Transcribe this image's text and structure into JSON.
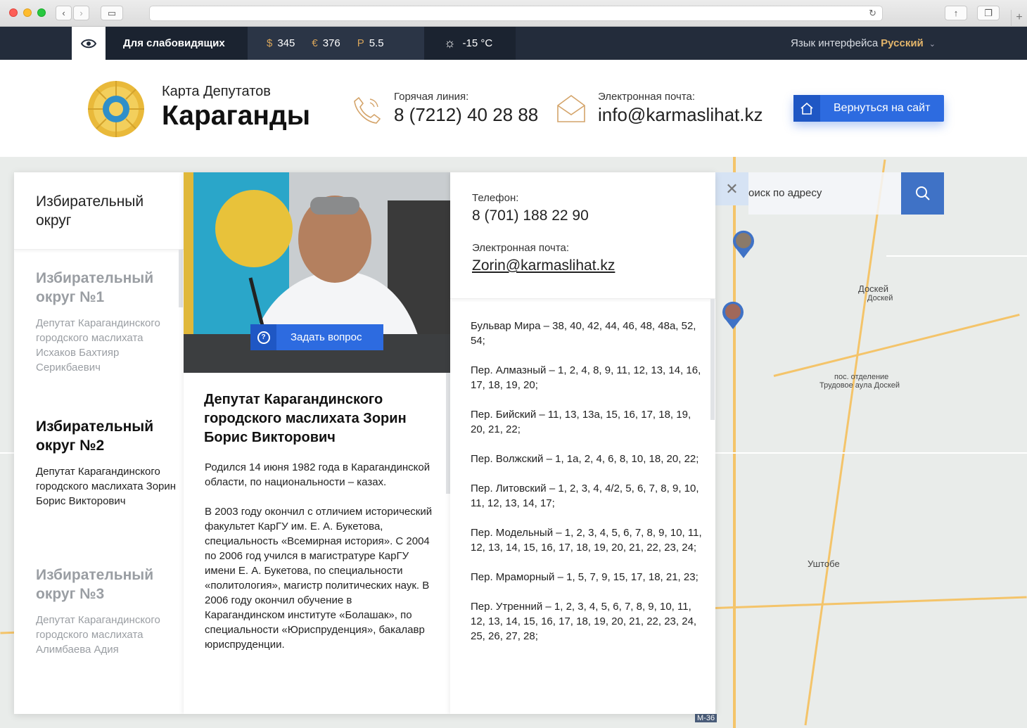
{
  "browser": {
    "url": ""
  },
  "topbar": {
    "low_vision_label": "Для слабовидящих",
    "currencies": [
      {
        "symbol": "$",
        "value": "345"
      },
      {
        "symbol": "€",
        "value": "376"
      },
      {
        "symbol": "Р",
        "value": "5.5"
      }
    ],
    "weather": "-15 °C",
    "language_label": "Язык интерфейса",
    "language_value": "Русский"
  },
  "header": {
    "brand_sub": "Карта Депутатов",
    "brand_title": "Караганды",
    "hotline_label": "Горячая линия:",
    "hotline_value": "8 (7212) 40 28 88",
    "email_label": "Электронная почта:",
    "email_value": "info@karmaslihat.kz",
    "back_button": "Вернуться на сайт"
  },
  "search": {
    "placeholder": "оиск по адресу"
  },
  "map": {
    "labels": [
      {
        "text": "Доскей"
      },
      {
        "text": "Доскей"
      },
      {
        "text": "пос. отделение"
      },
      {
        "text": "Трудовое аула Доскей"
      },
      {
        "text": "Уштобе"
      },
      {
        "text": "М-36"
      }
    ]
  },
  "districts_panel": {
    "heading": "Избирательный округ",
    "districts": [
      {
        "name": "Избирательный округ №1",
        "desc": "Депутат Карагандинского городского маслихата Исхаков Бахтияр Серикбаевич"
      },
      {
        "name": "Избирательный округ №2",
        "desc": "Депутат Карагандинского городского маслихата Зорин Борис Викторович"
      },
      {
        "name": "Избирательный округ №3",
        "desc": "Депутат Карагандинского городского маслихата Алимбаева Адия"
      }
    ]
  },
  "deputy": {
    "ask_button": "Задать вопрос",
    "name": "Депутат Карагандинского городского маслихата Зорин Борис Викторович",
    "bio": [
      "Родился 14 июня 1982 года в Карагандинской области, по национальности – казах.",
      "В 2003 году окончил с отличием исторический факультет КарГУ им. Е. А. Букетова, специальность «Всемирная история». С 2004 по 2006 год учился в магистратуре КарГУ имени Е. А. Букетова, по специальности «политология», магистр политических наук. В 2006 году окончил обучение в Карагандинском институте «Болашак», по специальности «Юриспруденция», бакалавр юриспруденции."
    ],
    "phone_label": "Телефон:",
    "phone_value": "8 (701) 188 22 90",
    "email_label": "Электронная почта:",
    "email_value": "Zorin@karmaslihat.kz",
    "streets": [
      "Бульвар Мира – 38, 40, 42, 44, 46, 48, 48а, 52, 54;",
      "Пер. Алмазный – 1, 2, 4, 8, 9, 11, 12, 13, 14, 16, 17, 18, 19, 20;",
      "Пер. Бийский – 11, 13, 13а, 15, 16, 17, 18, 19, 20, 21, 22;",
      "Пер. Волжский – 1, 1а, 2, 4, 6, 8, 10, 18, 20, 22;",
      "Пер. Литовский – 1, 2, 3, 4, 4/2, 5, 6, 7, 8, 9, 10, 11, 12, 13, 14, 17;",
      "Пер. Модельный – 1, 2, 3, 4, 5, 6, 7, 8, 9, 10, 11, 12, 13, 14, 15, 16, 17, 18, 19, 20, 21, 22, 23, 24;",
      "Пер. Мраморный – 1, 5, 7, 9, 15, 17, 18, 21, 23;",
      "Пер. Утренний – 1, 2, 3, 4, 5, 6, 7, 8, 9, 10, 11, 12, 13, 14, 15, 16, 17, 18, 19, 20, 21, 22, 23, 24, 25, 26, 27, 28;"
    ]
  },
  "colors": {
    "accent": "#2d6be0",
    "topbar": "#232c3b",
    "gold": "#e2b46a"
  }
}
